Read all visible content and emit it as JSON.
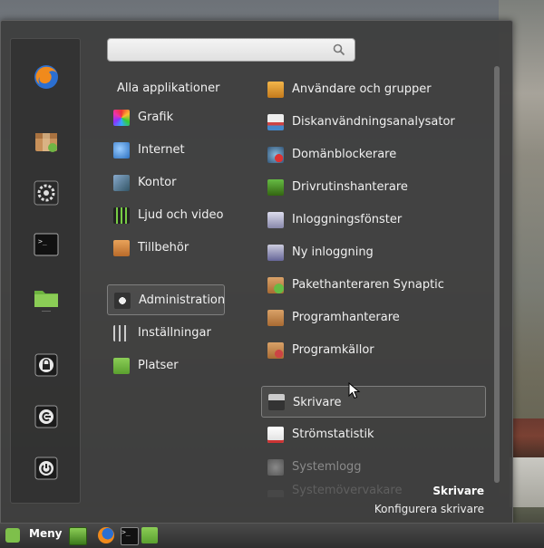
{
  "search": {
    "value": "",
    "placeholder": ""
  },
  "categories_header": "Alla applikationer",
  "categories": [
    {
      "label": "Grafik",
      "icon": "graphics-icon"
    },
    {
      "label": "Internet",
      "icon": "internet-icon"
    },
    {
      "label": "Kontor",
      "icon": "office-icon"
    },
    {
      "label": "Ljud och video",
      "icon": "multimedia-icon"
    },
    {
      "label": "Tillbehör",
      "icon": "accessories-icon"
    },
    {
      "label": "Administration",
      "icon": "administration-icon",
      "selected": true
    },
    {
      "label": "Inställningar",
      "icon": "settings-icon"
    },
    {
      "label": "Platser",
      "icon": "places-folder-icon"
    }
  ],
  "apps": [
    {
      "label": "Användare och grupper",
      "icon": "users-groups-icon"
    },
    {
      "label": "Diskanvändningsanalysator",
      "icon": "disk-usage-icon"
    },
    {
      "label": "Domänblockerare",
      "icon": "domain-blocker-icon"
    },
    {
      "label": "Drivrutinshanterare",
      "icon": "driver-manager-icon"
    },
    {
      "label": "Inloggningsfönster",
      "icon": "login-window-icon"
    },
    {
      "label": "Ny inloggning",
      "icon": "new-login-icon"
    },
    {
      "label": "Pakethanteraren Synaptic",
      "icon": "synaptic-icon"
    },
    {
      "label": "Programhanterare",
      "icon": "software-manager-icon"
    },
    {
      "label": "Programkällor",
      "icon": "software-sources-icon"
    },
    {
      "label": "Skrivare",
      "icon": "printer-icon",
      "hovered": true
    },
    {
      "label": "Strömstatistik",
      "icon": "power-statistics-icon"
    },
    {
      "label": "Systemlogg",
      "icon": "system-log-icon",
      "dimmed": true
    },
    {
      "label": "Systemövervakare",
      "icon": "system-monitor-icon",
      "faded": true
    }
  ],
  "info": {
    "title": "Skrivare",
    "description": "Konfigurera skrivare"
  },
  "favorites": [
    {
      "icon": "firefox-icon"
    },
    {
      "icon": "software-manager-icon"
    },
    {
      "icon": "system-settings-icon"
    },
    {
      "icon": "terminal-icon"
    },
    {
      "icon": "home-folder-icon"
    },
    {
      "icon": "lock-screen-icon"
    },
    {
      "icon": "logout-icon"
    },
    {
      "icon": "shutdown-icon"
    }
  ],
  "taskbar": {
    "menu_label": "Meny",
    "launchers": [
      "show-desktop-icon",
      "firefox-icon",
      "terminal-icon",
      "folder-icon"
    ]
  },
  "colors": {
    "panel_bg": "#3e3e3e",
    "accent_mint": "#7ec04b"
  }
}
